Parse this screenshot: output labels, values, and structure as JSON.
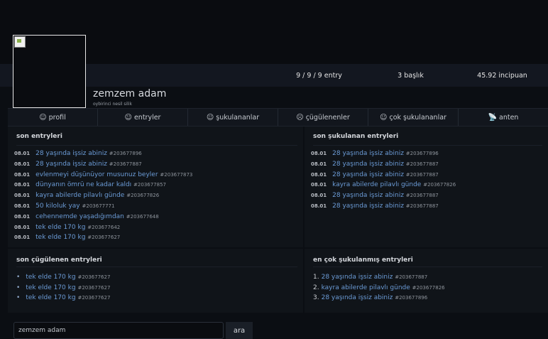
{
  "profile": {
    "username": "zemzem adam",
    "subtitle": "oybirinci nesil silik",
    "stats": {
      "entries": "9 / 9 / 9 entry",
      "topics": "3 başlık",
      "points": "45.92 incipuan"
    }
  },
  "tabs": [
    {
      "label": "profil",
      "icon": "☺"
    },
    {
      "label": "entryler",
      "icon": "☺"
    },
    {
      "label": "şukulananlar",
      "icon": "☺"
    },
    {
      "label": "çügülenenler",
      "icon": "☹"
    },
    {
      "label": "çok şukulananlar",
      "icon": "☺"
    },
    {
      "label": "anten",
      "icon": "📡"
    }
  ],
  "son_entryler": {
    "title": "son entryleri",
    "items": [
      {
        "date": "08.01",
        "title": "28 yaşında işsiz abiniz",
        "id": "#203677896"
      },
      {
        "date": "08.01",
        "title": "28 yaşında işsiz abiniz",
        "id": "#203677887"
      },
      {
        "date": "08.01",
        "title": "evlenmeyi düşünüyor musunuz beyler",
        "id": "#203677873"
      },
      {
        "date": "08.01",
        "title": "dünyanın ömrü ne kadar kaldı",
        "id": "#203677857"
      },
      {
        "date": "08.01",
        "title": "kayra abilerde pilavlı günde",
        "id": "#203677826"
      },
      {
        "date": "08.01",
        "title": "50 kiloluk yay",
        "id": "#203677771"
      },
      {
        "date": "08.01",
        "title": "cehennemde yaşadığımdan",
        "id": "#203677648"
      },
      {
        "date": "08.01",
        "title": "tek elde 170 kg",
        "id": "#203677642"
      },
      {
        "date": "08.01",
        "title": "tek elde 170 kg",
        "id": "#203677627"
      }
    ]
  },
  "son_sukulanan": {
    "title": "son şukulanan entryleri",
    "items": [
      {
        "date": "08.01",
        "title": "28 yaşında işsiz abiniz",
        "id": "#203677896"
      },
      {
        "date": "08.01",
        "title": "28 yaşında işsiz abiniz",
        "id": "#203677887"
      },
      {
        "date": "08.01",
        "title": "28 yaşında işsiz abiniz",
        "id": "#203677887"
      },
      {
        "date": "08.01",
        "title": "kayra abilerde pilavlı günde",
        "id": "#203677826"
      },
      {
        "date": "08.01",
        "title": "28 yaşında işsiz abiniz",
        "id": "#203677887"
      },
      {
        "date": "08.01",
        "title": "28 yaşında işsiz abiniz",
        "id": "#203677887"
      }
    ]
  },
  "son_cugulenen": {
    "title": "son çügülenen entryleri",
    "items": [
      {
        "title": "tek elde 170 kg",
        "id": "#203677627"
      },
      {
        "title": "tek elde 170 kg",
        "id": "#203677627"
      },
      {
        "title": "tek elde 170 kg",
        "id": "#203677627"
      }
    ]
  },
  "en_cok_sukulanmis": {
    "title": "en çok şukulanmış entryleri",
    "items": [
      {
        "rank": "1.",
        "title": "28 yaşında işsiz abiniz",
        "id": "#203677887"
      },
      {
        "rank": "2.",
        "title": "kayra abilerde pilavlı günde",
        "id": "#203677826"
      },
      {
        "rank": "3.",
        "title": "28 yaşında işsiz abiniz",
        "id": "#203677896"
      }
    ]
  },
  "search": {
    "value": "zemzem adam",
    "button": "ara"
  },
  "colors": {
    "background": "#0b0e13",
    "panel": "#101419",
    "link": "#6b9bd6"
  }
}
